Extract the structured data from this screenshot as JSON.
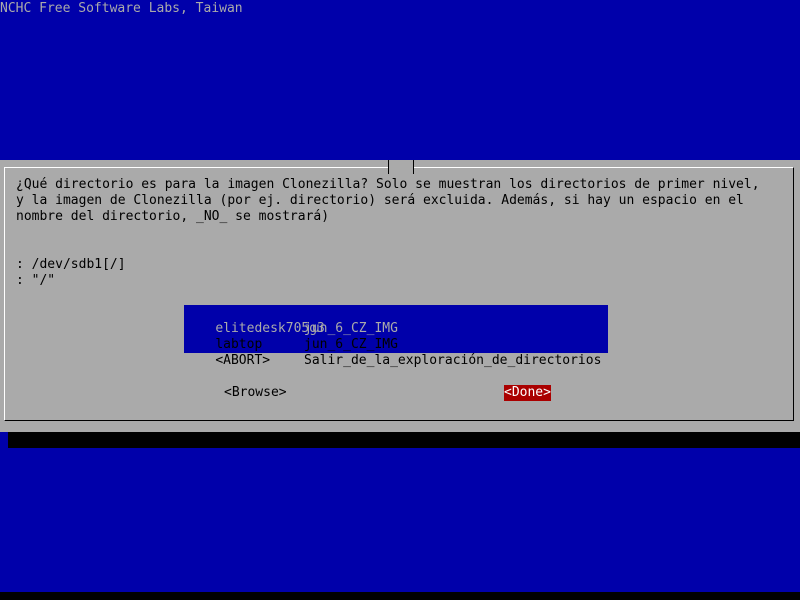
{
  "backtitle": "NCHC Free Software Labs, Taiwan",
  "dialog": {
    "prompt_lines": [
      "¿Qué directorio es para la imagen Clonezilla? Solo se muestran los directorios de primer nivel,",
      "y la imagen de Clonezilla (por ej. directorio) será excluida. Además, si hay un espacio en el",
      "nombre del directorio, _NO_ se mostrará)"
    ],
    "info_lines": [
      ": /dev/sdb1[/]",
      ": \"/\""
    ],
    "menu": [
      {
        "tag": "elitedesk705g3",
        "item": "jun_6_CZ_IMG",
        "selected": true
      },
      {
        "tag": "labtop",
        "item": "jun_6_CZ_IMG",
        "selected": false
      },
      {
        "tag": "<ABORT>",
        "item": "Salir_de_la_exploración_de_directorios",
        "selected": false
      }
    ],
    "buttons": {
      "browse": "<Browse>",
      "done": "<Done>"
    }
  },
  "colors": {
    "background": "#0000aa",
    "dialog": "#aaaaaa",
    "selection": "#0000aa",
    "done_button": "#aa0000"
  }
}
